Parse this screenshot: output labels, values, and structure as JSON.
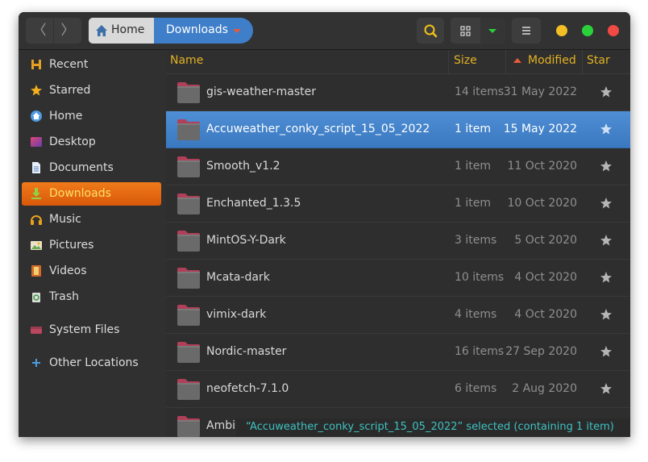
{
  "nav": {
    "back_label": "〈",
    "forward_label": "〉"
  },
  "breadcrumb": {
    "home": "Home",
    "current": "Downloads"
  },
  "window_controls": {
    "minimize_color": "#f3bf24",
    "maximize_color": "#2ad13a",
    "close_color": "#f04a45"
  },
  "sidebar": {
    "items": [
      {
        "label": "Recent",
        "icon": "recent-icon"
      },
      {
        "label": "Starred",
        "icon": "star-icon"
      },
      {
        "label": "Home",
        "icon": "home-icon"
      },
      {
        "label": "Desktop",
        "icon": "desktop-icon"
      },
      {
        "label": "Documents",
        "icon": "documents-icon"
      },
      {
        "label": "Downloads",
        "icon": "downloads-icon",
        "active": true
      },
      {
        "label": "Music",
        "icon": "music-icon"
      },
      {
        "label": "Pictures",
        "icon": "pictures-icon"
      },
      {
        "label": "Videos",
        "icon": "videos-icon"
      },
      {
        "label": "Trash",
        "icon": "trash-icon"
      },
      {
        "label": "System Files",
        "icon": "drive-icon"
      },
      {
        "label": "Other Locations",
        "icon": "plus-icon"
      }
    ]
  },
  "columns": {
    "name": "Name",
    "size": "Size",
    "modified": "Modified",
    "star": "Star"
  },
  "files": [
    {
      "name": "gis-weather-master",
      "size": "14 items",
      "modified": "31 May 2022"
    },
    {
      "name": "Accuweather_conky_script_15_05_2022",
      "size": "1 item",
      "modified": "15 May 2022",
      "selected": true
    },
    {
      "name": "Smooth_v1.2",
      "size": "1 item",
      "modified": "11 Oct 2020"
    },
    {
      "name": "Enchanted_1.3.5",
      "size": "1 item",
      "modified": "10 Oct 2020"
    },
    {
      "name": "MintOS-Y-Dark",
      "size": "3 items",
      "modified": "5 Oct 2020"
    },
    {
      "name": "Mcata-dark",
      "size": "10 items",
      "modified": "4 Oct 2020"
    },
    {
      "name": "vimix-dark",
      "size": "4 items",
      "modified": "4 Oct 2020"
    },
    {
      "name": "Nordic-master",
      "size": "16 items",
      "modified": "27 Sep 2020"
    },
    {
      "name": "neofetch-7.1.0",
      "size": "6 items",
      "modified": "2 Aug 2020"
    },
    {
      "name": "Ambi",
      "size": "",
      "modified": ""
    }
  ],
  "status": {
    "text": "“Accuweather_conky_script_15_05_2022” selected  (containing 1 item)"
  },
  "colors": {
    "accent": "#3f7fc9",
    "sidebar_active": "#e86a12",
    "header_text": "#e3b224",
    "status_text": "#3fc1c1"
  }
}
